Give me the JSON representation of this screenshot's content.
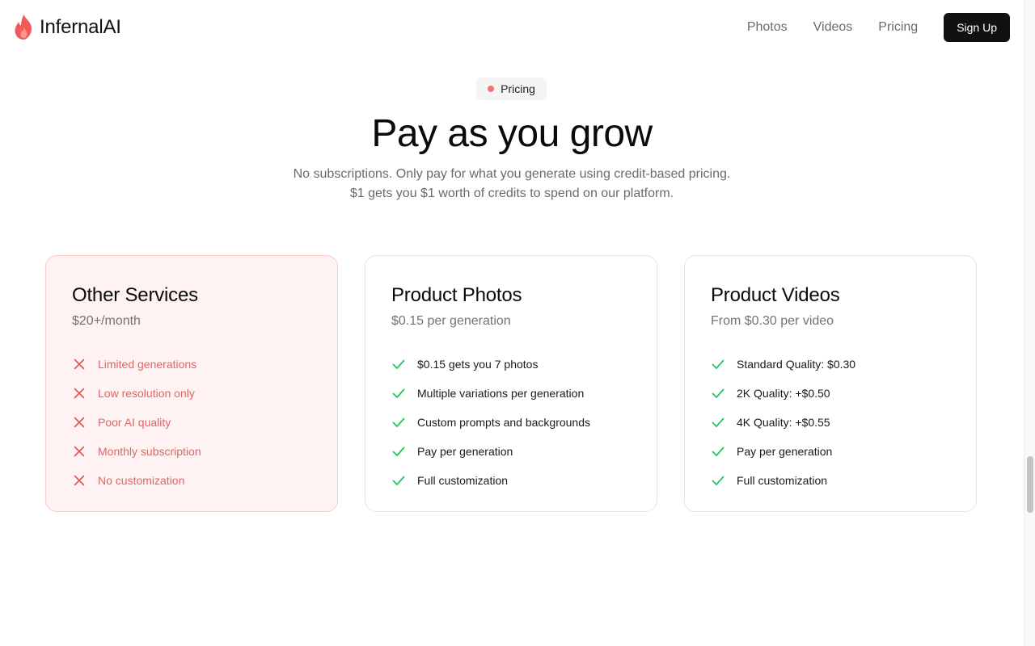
{
  "brand": {
    "name": "InfernalAI",
    "icon": "flame-icon",
    "color": "#f05a5a"
  },
  "nav": {
    "links": [
      "Photos",
      "Videos",
      "Pricing"
    ],
    "signup_label": "Sign Up"
  },
  "hero": {
    "badge": "Pricing",
    "title": "Pay as you grow",
    "subtitle_lines": [
      "No subscriptions. Only pay for what you generate using credit-based pricing.",
      "$1 gets you $1 worth of credits to spend on our platform."
    ]
  },
  "cards": [
    {
      "title": "Other Services",
      "price": "$20+/month",
      "icon": "x-icon",
      "features": [
        "Limited generations",
        "Low resolution only",
        "Poor AI quality",
        "Monthly subscription",
        "No customization"
      ]
    },
    {
      "title": "Product Photos",
      "price": "$0.15 per generation",
      "icon": "check-icon",
      "features": [
        "$0.15 gets you 7 photos",
        "Multiple variations per generation",
        "Custom prompts and backgrounds",
        "Pay per generation",
        "Full customization"
      ]
    },
    {
      "title": "Product Videos",
      "price": "From $0.30 per video",
      "icon": "check-icon",
      "features": [
        "Standard Quality: $0.30",
        "2K Quality: +$0.50",
        "4K Quality: +$0.55",
        "Pay per generation",
        "Full customization"
      ]
    }
  ],
  "colors": {
    "accent": "#f87171",
    "check": "#22c55e",
    "x": "#e05555",
    "negative_card_bg": "#fef2f2"
  }
}
